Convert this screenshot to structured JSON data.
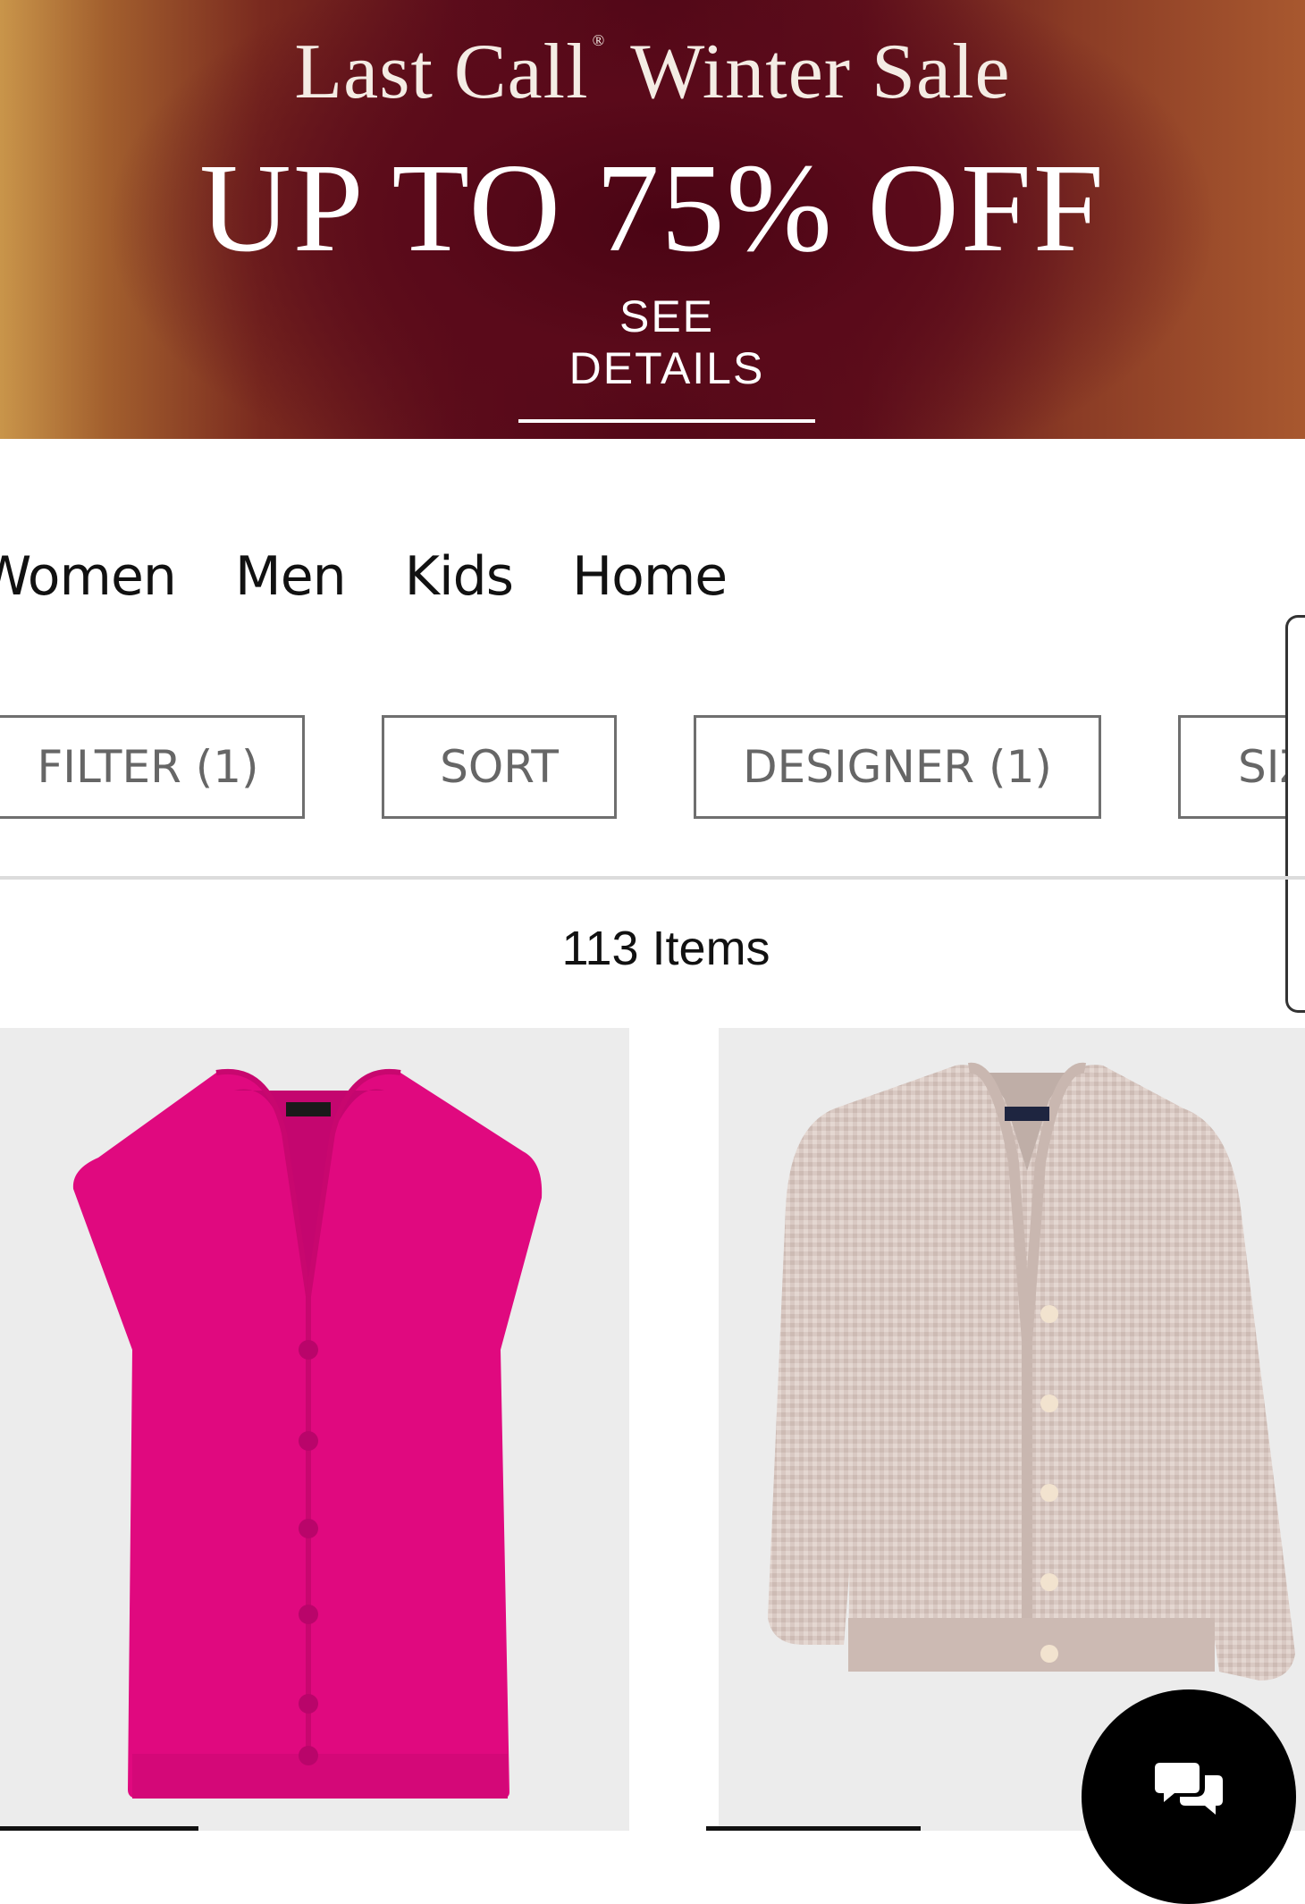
{
  "banner": {
    "title_part1": "Last Call",
    "title_mark": "®",
    "title_part2": "Winter Sale",
    "headline": "UP TO 75% OFF",
    "cta": "SEE DETAILS"
  },
  "categories": [
    "Women",
    "Men",
    "Kids",
    "Home"
  ],
  "chips": {
    "filter": "FILTER (1)",
    "sort": "SORT",
    "designer": "DESIGNER (1)",
    "size": "SIZ"
  },
  "results": {
    "count_label": "113 Items"
  },
  "products": [
    {
      "image": "magenta-knit-vest",
      "color": "#e0097f"
    },
    {
      "image": "beige-waffle-knit-cardigan",
      "color": "#d8c8c2"
    }
  ],
  "chat": {
    "icon": "chat-bubbles-icon"
  }
}
